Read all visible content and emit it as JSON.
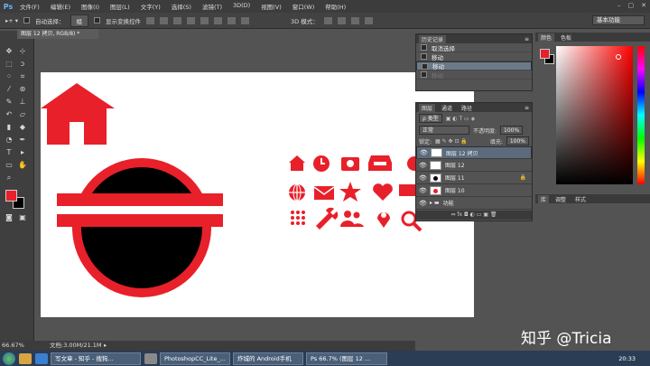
{
  "app": {
    "logo": "Ps"
  },
  "menu": [
    "文件(F)",
    "编辑(E)",
    "图像(I)",
    "图层(L)",
    "文字(Y)",
    "选择(S)",
    "滤镜(T)",
    "3D(D)",
    "视图(V)",
    "窗口(W)",
    "帮助(H)"
  ],
  "window_controls": [
    "–",
    "▢",
    "✕"
  ],
  "options": {
    "auto_select_label": "自动选择：",
    "auto_select_value": "组",
    "show_transform_label": "显示变换控件",
    "mode_3d_label": "3D 模式：",
    "workspace": "基本功能"
  },
  "document": {
    "tab_label": "图层 12 拷贝, RGB/8) *"
  },
  "status": {
    "zoom": "66.67%",
    "doc_info": "文档:3.00M/21.1M"
  },
  "history": {
    "tabs": [
      "历史记录"
    ],
    "rows": [
      {
        "label": "取消选择",
        "selected": false
      },
      {
        "label": "移动",
        "selected": false
      },
      {
        "label": "移动",
        "selected": true
      },
      {
        "label": "移动",
        "selected": false,
        "dimmed": true
      }
    ]
  },
  "layers": {
    "tabs": [
      "图层",
      "通道",
      "路径"
    ],
    "filter_label": "ρ 类型",
    "blend_mode": "正常",
    "opacity_label": "不透明度:",
    "opacity_value": "100%",
    "lock_label": "锁定:",
    "fill_label": "填充:",
    "fill_value": "100%",
    "rows": [
      {
        "name": "图层 12 拷贝",
        "selected": true
      },
      {
        "name": "图层 12",
        "selected": false
      },
      {
        "name": "图层 11",
        "selected": false
      },
      {
        "name": "图层 10",
        "selected": false
      },
      {
        "name": "功能",
        "selected": false,
        "group": true
      }
    ],
    "footer_icons": "⇔ fx ◘ ◐ ▭ ▣ 🗑"
  },
  "color_panel": {
    "tabs": [
      "颜色",
      "色板"
    ],
    "foreground": "#e8202a",
    "background": "#000000"
  },
  "adjust_panel": {
    "tabs": [
      "库",
      "调整",
      "样式"
    ]
  },
  "taskbar": {
    "items": [
      "写文章 - 知乎 - 搜狗...",
      "PhotoshopCC_Lite_...",
      "炸城的 Android手机",
      "Ps 66.7% (图层 12 ..."
    ],
    "clock": "20:33"
  },
  "watermark": "知乎 @Tricia",
  "colors": {
    "accent_red": "#e8202a",
    "canvas": "#ffffff",
    "ui_dark": "#535353"
  }
}
